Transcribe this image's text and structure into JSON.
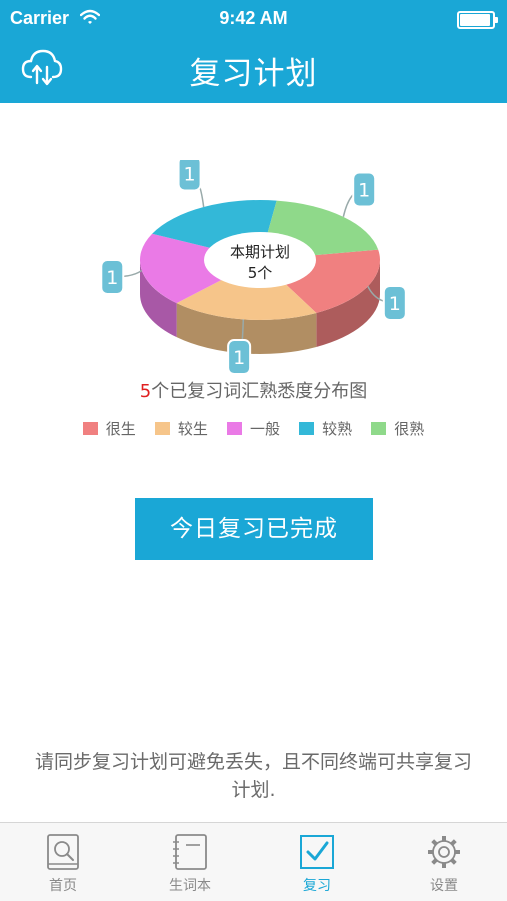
{
  "status_bar": {
    "carrier": "Carrier",
    "time": "9:42 AM"
  },
  "nav": {
    "title": "复习计划",
    "sync_icon": "cloud-sync-icon"
  },
  "chart_data": {
    "type": "pie",
    "center_label": "本期计划",
    "center_count": "5个",
    "categories": [
      "很生",
      "较生",
      "一般",
      "较熟",
      "很熟"
    ],
    "values": [
      1,
      1,
      1,
      1,
      1
    ],
    "colors": [
      "#f08080",
      "#f6c58a",
      "#ea7ae6",
      "#33b8d8",
      "#8fd98a"
    ],
    "caption_number": "5",
    "caption_text": "个已复习词汇熟悉度分布图"
  },
  "actions": {
    "done_label": "今日复习已完成"
  },
  "hint": "请同步复习计划可避免丢失，且不同终端可共享复习计划.",
  "tabbar": {
    "tabs": [
      {
        "label": "首页",
        "icon": "book-search-icon"
      },
      {
        "label": "生词本",
        "icon": "notebook-icon"
      },
      {
        "label": "复习",
        "icon": "checkbox-icon",
        "active": true
      },
      {
        "label": "设置",
        "icon": "gear-icon"
      }
    ]
  }
}
